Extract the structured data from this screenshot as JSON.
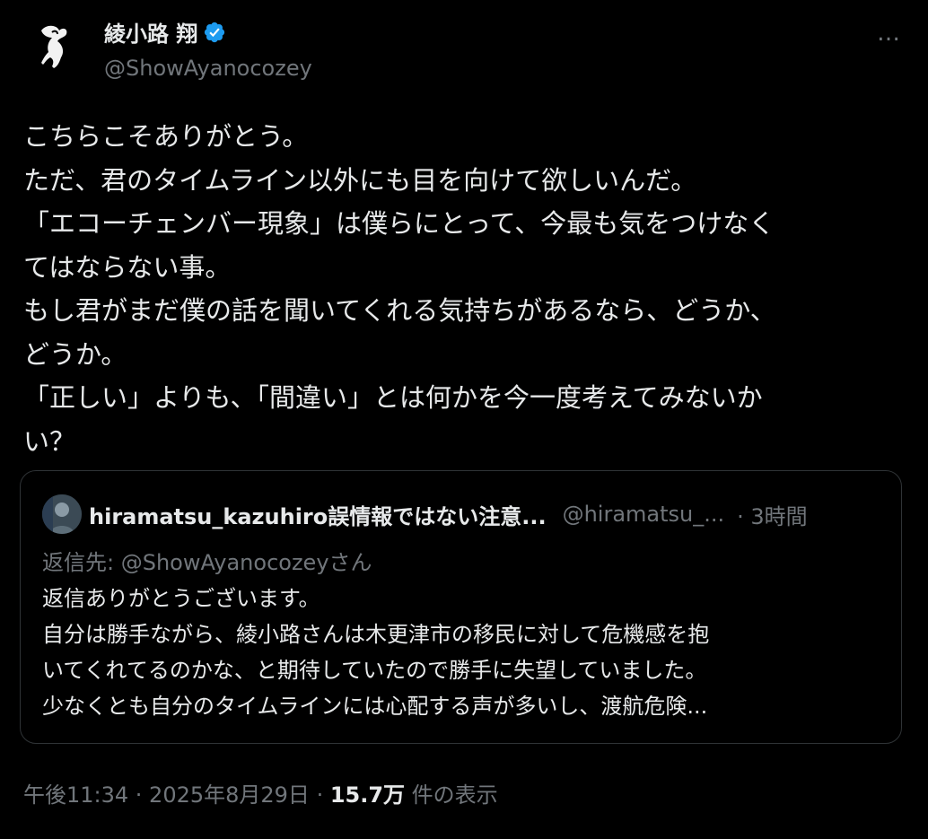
{
  "author": {
    "name": "綾小路 翔",
    "handle": "@ShowAyanocozey",
    "verified_color": "#1d9bf0"
  },
  "more_icon": "…",
  "tweet": {
    "lines": [
      "こちらこそありがとう。",
      "ただ、君のタイムライン以外にも目を向けて欲しいんだ。",
      "「エコーチェンバー現象」は僕らにとって、今最も気をつけなく",
      "てはならない事。",
      "もし君がまだ僕の話を聞いてくれる気持ちがあるなら、どうか、",
      "どうか。",
      "「正しい」よりも、「間違い」とは何かを今一度考えてみないか",
      "い？"
    ]
  },
  "quote": {
    "name": "hiramatsu_kazuhiro誤情報ではない注意...",
    "handle": "@hiramatsu_...",
    "time": "· 3時間",
    "reply_to_prefix": "返信先: ",
    "reply_to_handle": "@ShowAyanocozeyさん",
    "lines": [
      "返信ありがとうございます。",
      "自分は勝手ながら、綾小路さんは木更津市の移民に対して危機感を抱",
      "いてくれてるのかな、と期待していたので勝手に失望していました。",
      "少なくとも自分のタイムラインには心配する声が多いし、渡航危険..."
    ]
  },
  "meta": {
    "datetime": "午後11:34 · 2025年8月29日 · ",
    "views": "15.7万",
    "views_suffix": " 件の表示"
  }
}
